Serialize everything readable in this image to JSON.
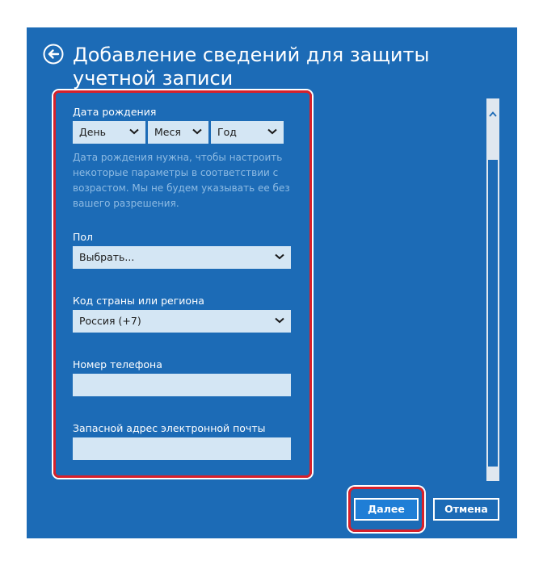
{
  "window": {
    "title": "Добавление сведений для защиты учетной записи"
  },
  "birth_date": {
    "label": "Дата рождения",
    "day": "День",
    "month": "Меся",
    "year": "Год",
    "hint": "Дата рождения нужна, чтобы настроить некоторые параметры в соответствии с возрастом. Мы не будем указывать ее без вашего разрешения."
  },
  "gender": {
    "label": "Пол",
    "value": "Выбрать..."
  },
  "country_code": {
    "label": "Код страны или региона",
    "value": "Россия (+7)"
  },
  "phone": {
    "label": "Номер телефона",
    "value": ""
  },
  "backup_email": {
    "label": "Запасной адрес электронной почты",
    "value": ""
  },
  "buttons": {
    "next": "Далее",
    "cancel": "Отмена"
  },
  "colors": {
    "background": "#1c6bb6",
    "field": "#d4e6f4",
    "highlight": "#d8202a",
    "hint_text": "#8ebbe3"
  },
  "icons": {
    "back": "back-arrow-icon",
    "dropdown": "chevron-down-icon"
  }
}
